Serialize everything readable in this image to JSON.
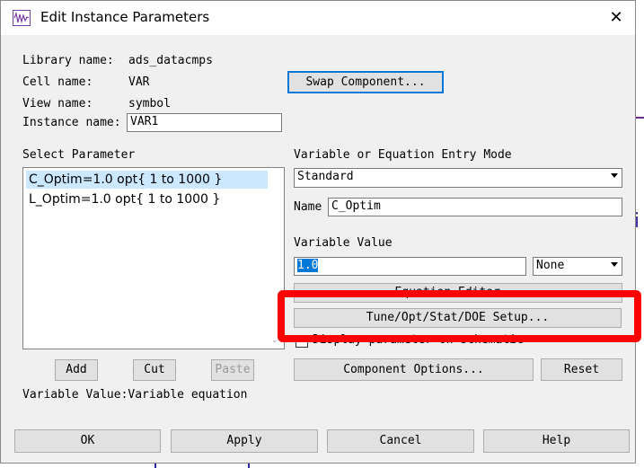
{
  "window": {
    "title": "Edit Instance Parameters",
    "close_glyph": "✕"
  },
  "info": {
    "library_label": "Library name:",
    "library_value": "ads_datacmps",
    "cell_label": "Cell name:",
    "cell_value": "VAR",
    "view_label": "View name:",
    "view_value": "symbol",
    "instance_label": "Instance name:",
    "instance_value": "VAR1"
  },
  "swap_button": "Swap Component...",
  "params": {
    "label": "Select Parameter",
    "items": [
      "C_Optim=1.0 opt{ 1 to 1000 }",
      "L_Optim=1.0 opt{ 1 to 1000 }"
    ],
    "selected_index": 0
  },
  "list_buttons": {
    "add": "Add",
    "cut": "Cut",
    "paste": "Paste"
  },
  "status_text": "Variable Value:Variable equation",
  "entry_mode": {
    "label": "Variable or Equation Entry Mode",
    "value": "Standard"
  },
  "name_field": {
    "label": "Name",
    "value": "C_Optim"
  },
  "variable_value": {
    "label": "Variable Value",
    "value": "1.0",
    "unit": "None"
  },
  "equation_editor_button": "Equation Editor...",
  "tune_button": "Tune/Opt/Stat/DOE Setup...",
  "display_checkbox_label": "Display parameter on schematic",
  "component_options_button": "Component Options...",
  "reset_button": "Reset",
  "footer": {
    "ok": "OK",
    "apply": "Apply",
    "cancel": "Cancel",
    "help": "Help"
  },
  "colors": {
    "highlight": "#ff0000",
    "selection": "#0078d7",
    "list_selection": "#cce8ff"
  }
}
